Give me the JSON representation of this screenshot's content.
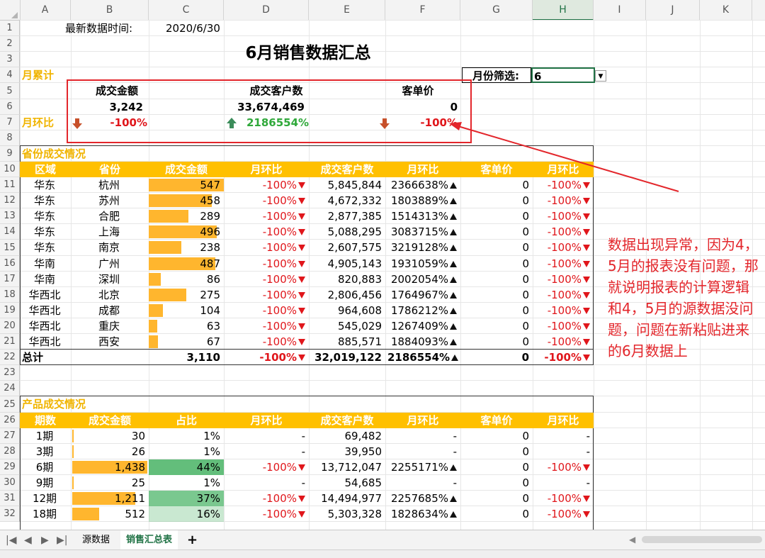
{
  "columns": [
    "A",
    "B",
    "C",
    "D",
    "E",
    "F",
    "G",
    "H",
    "I",
    "J",
    "K"
  ],
  "rows": [
    "1",
    "2",
    "3",
    "4",
    "5",
    "6",
    "7",
    "8",
    "9",
    "10",
    "11",
    "12",
    "13",
    "14",
    "15",
    "16",
    "17",
    "18",
    "19",
    "20",
    "21",
    "22",
    "23",
    "24",
    "25",
    "26",
    "27",
    "28",
    "29",
    "30",
    "31",
    "32"
  ],
  "top": {
    "latest_label": "最新数据时间:",
    "latest_value": "2020/6/30",
    "title": "6月销售数据汇总",
    "month_cum": "月累计",
    "filter_label": "月份筛选:",
    "filter_value": "6",
    "mom_label": "月环比"
  },
  "kpi": {
    "headers": [
      "成交金额",
      "成交客户数",
      "客单价"
    ],
    "values": [
      "3,242",
      "33,674,469",
      "0"
    ],
    "changes": [
      "-100%",
      "2186554%",
      "-100%"
    ]
  },
  "province": {
    "section_title": "省份成交情况",
    "headers": [
      "区域",
      "省份",
      "成交金额",
      "月环比",
      "成交客户数",
      "月环比",
      "客单价",
      "月环比"
    ],
    "rows": [
      {
        "region": "华东",
        "prov": "杭州",
        "amt": "547",
        "amt_v": 547,
        "mom": "-100%",
        "cust": "5,845,844",
        "cmom": "2366638%",
        "price": "0",
        "pmom": "-100%"
      },
      {
        "region": "华东",
        "prov": "苏州",
        "amt": "458",
        "amt_v": 458,
        "mom": "-100%",
        "cust": "4,672,332",
        "cmom": "1803889%",
        "price": "0",
        "pmom": "-100%"
      },
      {
        "region": "华东",
        "prov": "合肥",
        "amt": "289",
        "amt_v": 289,
        "mom": "-100%",
        "cust": "2,877,385",
        "cmom": "1514313%",
        "price": "0",
        "pmom": "-100%"
      },
      {
        "region": "华东",
        "prov": "上海",
        "amt": "496",
        "amt_v": 496,
        "mom": "-100%",
        "cust": "5,088,295",
        "cmom": "3083715%",
        "price": "0",
        "pmom": "-100%"
      },
      {
        "region": "华东",
        "prov": "南京",
        "amt": "238",
        "amt_v": 238,
        "mom": "-100%",
        "cust": "2,607,575",
        "cmom": "3219128%",
        "price": "0",
        "pmom": "-100%"
      },
      {
        "region": "华南",
        "prov": "广州",
        "amt": "487",
        "amt_v": 487,
        "mom": "-100%",
        "cust": "4,905,143",
        "cmom": "1931059%",
        "price": "0",
        "pmom": "-100%"
      },
      {
        "region": "华南",
        "prov": "深圳",
        "amt": "86",
        "amt_v": 86,
        "mom": "-100%",
        "cust": "820,883",
        "cmom": "2002054%",
        "price": "0",
        "pmom": "-100%"
      },
      {
        "region": "华西北",
        "prov": "北京",
        "amt": "275",
        "amt_v": 275,
        "mom": "-100%",
        "cust": "2,806,456",
        "cmom": "1764967%",
        "price": "0",
        "pmom": "-100%"
      },
      {
        "region": "华西北",
        "prov": "成都",
        "amt": "104",
        "amt_v": 104,
        "mom": "-100%",
        "cust": "964,608",
        "cmom": "1786212%",
        "price": "0",
        "pmom": "-100%"
      },
      {
        "region": "华西北",
        "prov": "重庆",
        "amt": "63",
        "amt_v": 63,
        "mom": "-100%",
        "cust": "545,029",
        "cmom": "1267409%",
        "price": "0",
        "pmom": "-100%"
      },
      {
        "region": "华西北",
        "prov": "西安",
        "amt": "67",
        "amt_v": 67,
        "mom": "-100%",
        "cust": "885,571",
        "cmom": "1884093%",
        "price": "0",
        "pmom": "-100%"
      }
    ],
    "total": {
      "label": "总计",
      "amt": "3,110",
      "mom": "-100%",
      "cust": "32,019,122",
      "cmom": "2186554%",
      "price": "0",
      "pmom": "-100%"
    }
  },
  "product": {
    "section_title": "产品成交情况",
    "headers": [
      "期数",
      "成交金额",
      "占比",
      "月环比",
      "成交客户数",
      "月环比",
      "客单价",
      "月环比"
    ],
    "rows": [
      {
        "period": "1期",
        "amt": "30",
        "amt_v": 30,
        "share": "1%",
        "share_v": 1,
        "mom": "-",
        "cust": "69,482",
        "cmom": "-",
        "price": "0",
        "pmom": "-"
      },
      {
        "period": "3期",
        "amt": "26",
        "amt_v": 26,
        "share": "1%",
        "share_v": 1,
        "mom": "-",
        "cust": "39,950",
        "cmom": "-",
        "price": "0",
        "pmom": "-"
      },
      {
        "period": "6期",
        "amt": "1,438",
        "amt_v": 1438,
        "share": "44%",
        "share_v": 44,
        "mom": "-100%",
        "cust": "13,712,047",
        "cmom": "2255171%",
        "price": "0",
        "pmom": "-100%"
      },
      {
        "period": "9期",
        "amt": "25",
        "amt_v": 25,
        "share": "1%",
        "share_v": 1,
        "mom": "-",
        "cust": "54,685",
        "cmom": "-",
        "price": "0",
        "pmom": "-"
      },
      {
        "period": "12期",
        "amt": "1,211",
        "amt_v": 1211,
        "share": "37%",
        "share_v": 37,
        "mom": "-100%",
        "cust": "14,494,977",
        "cmom": "2257685%",
        "price": "0",
        "pmom": "-100%"
      },
      {
        "period": "18期",
        "amt": "512",
        "amt_v": 512,
        "share": "16%",
        "share_v": 16,
        "mom": "-100%",
        "cust": "5,303,328",
        "cmom": "1828634%",
        "price": "0",
        "pmom": "-100%"
      }
    ]
  },
  "annotation": "数据出现异常，因为4，5月的报表没有问题，那就说明报表的计算逻辑和4，5月的源数据没问题，问题在新粘贴进来的6月数据上",
  "tabs": [
    "源数据",
    "销售汇总表"
  ],
  "tab_add": "+",
  "colors": {
    "gold": "#ffc000",
    "red": "#e0161b",
    "green": "#2fa83a",
    "bar": "#ffb62e",
    "share": "#63be7b",
    "accent": "#217346"
  }
}
